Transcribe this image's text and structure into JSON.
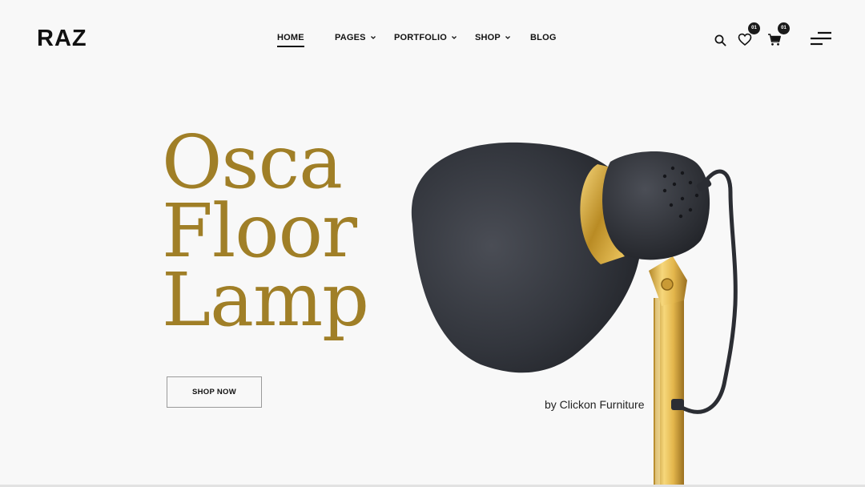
{
  "brand": {
    "logo": "RAZ"
  },
  "nav": {
    "items": [
      {
        "label": "HOME",
        "dropdown": false,
        "active": true
      },
      {
        "label": "PAGES",
        "dropdown": true
      },
      {
        "label": "PORTFOLIO",
        "dropdown": true
      },
      {
        "label": "SHOP",
        "dropdown": true
      },
      {
        "label": "BLOG",
        "dropdown": false
      }
    ]
  },
  "header_icons": {
    "search": "search-icon",
    "wishlist": "heart-icon",
    "wishlist_count": "01",
    "cart": "cart-icon",
    "cart_count": "01",
    "menu": "hamburger-menu-icon"
  },
  "hero": {
    "title_lines": [
      "Osca",
      "Floor",
      "Lamp"
    ],
    "button_label": "SHOP NOW",
    "byline": "by Clickon Furniture",
    "accent_color": "#a07f27",
    "image": "black-floor-lamp-gold-stem"
  }
}
